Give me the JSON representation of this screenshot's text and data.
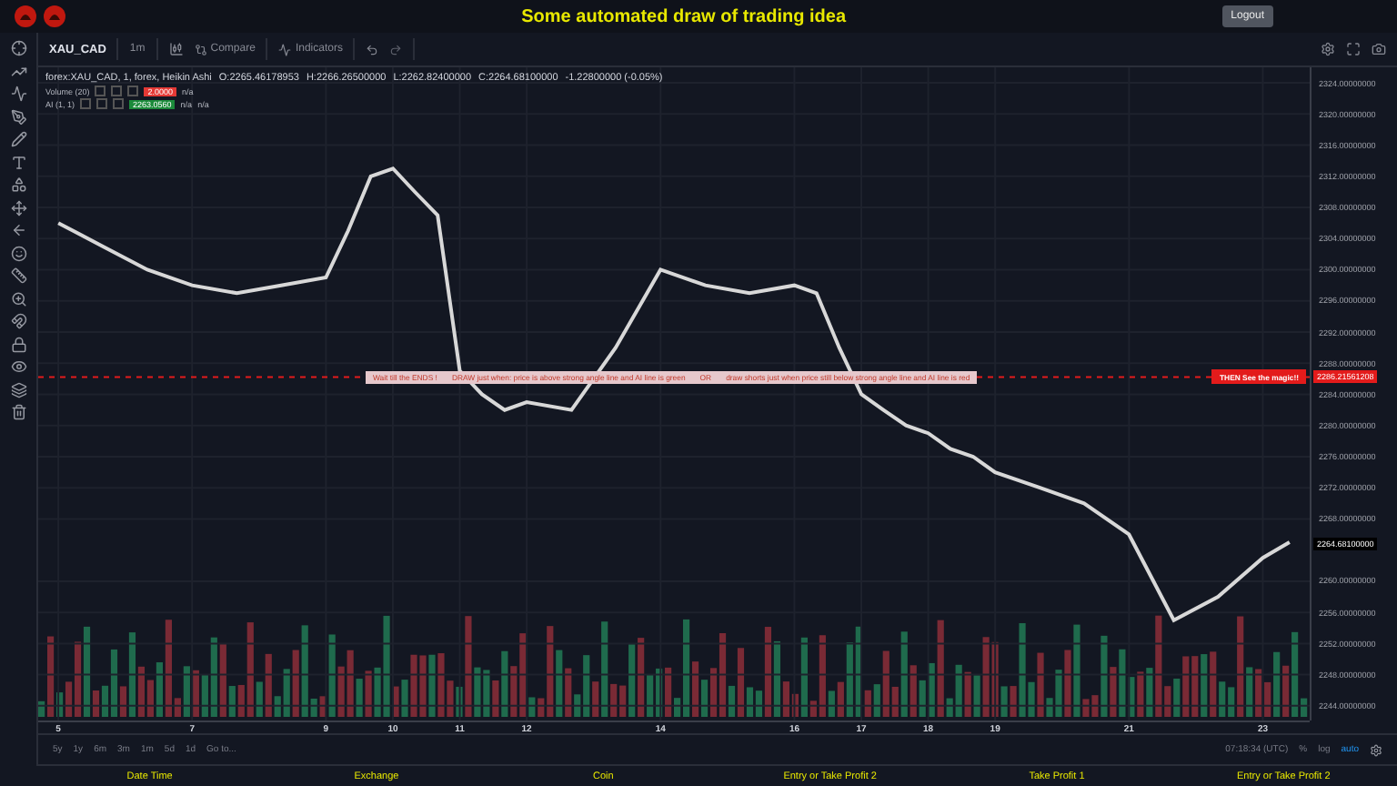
{
  "header": {
    "title": "Some automated draw of trading idea",
    "logout": "Logout"
  },
  "toolbar": {
    "symbol": "XAU_CAD",
    "interval": "1m",
    "compare": "Compare",
    "indicators": "Indicators"
  },
  "legend": {
    "series": "forex:XAU_CAD, 1, forex, Heikin Ashi",
    "open": "O:2265.46178953",
    "high": "H:2266.26500000",
    "low": "L:2262.82400000",
    "close": "C:2264.68100000",
    "change": "-1.22800000 (-0.05%)",
    "studies": [
      {
        "name": "Volume (20)",
        "value": "2.0000",
        "color": "#e53935",
        "extra": [
          "n/a"
        ]
      },
      {
        "name": "AI (1, 1)",
        "value": "2263.0560",
        "color": "#1b8a3a",
        "extra": [
          "n/a",
          "n/a"
        ]
      }
    ]
  },
  "chart": {
    "chart_data": {
      "type": "line",
      "x": [
        5,
        5.67,
        6.33,
        7,
        7.67,
        8.33,
        9,
        9.33,
        9.67,
        10,
        10.33,
        10.67,
        11,
        11.33,
        11.67,
        12,
        12.67,
        13.33,
        14,
        14.67,
        15.33,
        16,
        16.33,
        16.67,
        17,
        17.33,
        17.67,
        18,
        18.33,
        18.67,
        19,
        19.67,
        20.33,
        21,
        21.67,
        22.33,
        23,
        23.4
      ],
      "series": [
        {
          "color": "#d8d8d8",
          "values": [
            2306,
            2303,
            2300,
            2298,
            2297,
            2298,
            2299,
            2305,
            2312,
            2313,
            2310,
            2307,
            2287,
            2284,
            2282,
            2283,
            2282,
            2290,
            2300,
            2298,
            2297,
            2298,
            2297,
            2290,
            2284,
            2282,
            2280,
            2279,
            2277,
            2276,
            2274,
            2272,
            2270,
            2266,
            2255,
            2258,
            2263,
            2265
          ]
        }
      ],
      "grid": true,
      "ref_lines": [
        {
          "axis": "y",
          "value": 2286.21561208,
          "color": "#e31b1b"
        }
      ],
      "xlim": [
        4.7,
        23.7
      ],
      "ylim": [
        2242,
        2326
      ],
      "xticks": [
        5,
        7,
        9,
        10,
        11,
        12,
        14,
        16,
        17,
        18,
        19,
        21,
        23
      ],
      "yticks": [
        {
          "value": 2324,
          "label": "2324.00000000"
        },
        {
          "value": 2320,
          "label": "2320.00000000"
        },
        {
          "value": 2316,
          "label": "2316.00000000"
        },
        {
          "value": 2312,
          "label": "2312.00000000"
        },
        {
          "value": 2308,
          "label": "2308.00000000"
        },
        {
          "value": 2304,
          "label": "2304.00000000"
        },
        {
          "value": 2300,
          "label": "2300.00000000"
        },
        {
          "value": 2296,
          "label": "2296.00000000"
        },
        {
          "value": 2292,
          "label": "2292.00000000"
        },
        {
          "value": 2288,
          "label": "2288.00000000"
        },
        {
          "value": 2284,
          "label": "2284.00000000"
        },
        {
          "value": 2280,
          "label": "2280.00000000"
        },
        {
          "value": 2276,
          "label": "2276.00000000"
        },
        {
          "value": 2272,
          "label": "2272.00000000"
        },
        {
          "value": 2268,
          "label": "2268.00000000"
        },
        {
          "value": 2260,
          "label": "2260.00000000"
        },
        {
          "value": 2256,
          "label": "2256.00000000"
        },
        {
          "value": 2252,
          "label": "2252.00000000"
        },
        {
          "value": 2248,
          "label": "2248.00000000"
        },
        {
          "value": 2244,
          "label": "2244.00000000"
        }
      ]
    },
    "markers": [
      {
        "kind": "signal",
        "label": "2286.21561208"
      },
      {
        "kind": "last",
        "label": "2264.68100000"
      }
    ],
    "signal": {
      "parts": [
        "Wait till the ENDS !",
        "DRAW just when: price is above strong angle line and AI line is green",
        "OR",
        "draw shorts just when price still below strong angle line and AI line is red"
      ],
      "badge": "THEN See the magic!!"
    }
  },
  "ranges": [
    {
      "label": "5y"
    },
    {
      "label": "1y"
    },
    {
      "label": "6m"
    },
    {
      "label": "3m"
    },
    {
      "label": "1m"
    },
    {
      "label": "5d"
    },
    {
      "label": "1d"
    },
    {
      "label": "Go to..."
    }
  ],
  "status": {
    "time": "07:18:34 (UTC)",
    "percent": "%",
    "log": "log",
    "auto": "auto"
  },
  "footer": [
    "Date Time",
    "Exchange",
    "Coin",
    "Entry or Take Profit 2",
    "Take Profit 1",
    "Entry or Take Profit 2"
  ]
}
